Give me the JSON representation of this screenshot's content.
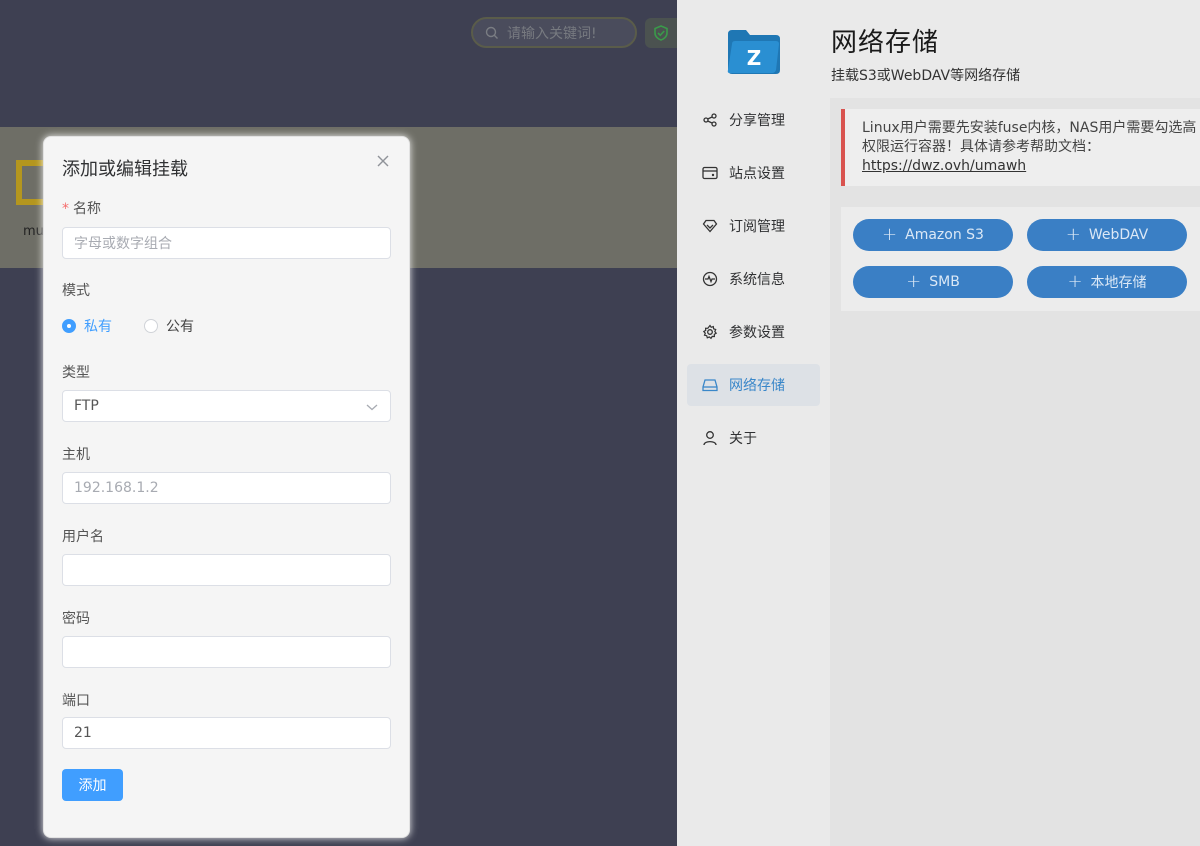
{
  "background": {
    "search_placeholder": "请输入关键词!",
    "fragment_text": "mu"
  },
  "sidebar": {
    "items": [
      {
        "label": "分享管理",
        "icon": "share-icon"
      },
      {
        "label": "站点设置",
        "icon": "site-icon"
      },
      {
        "label": "订阅管理",
        "icon": "subscription-icon"
      },
      {
        "label": "系统信息",
        "icon": "pulse-icon"
      },
      {
        "label": "参数设置",
        "icon": "gear-icon"
      },
      {
        "label": "网络存储",
        "icon": "drive-icon",
        "active": true
      },
      {
        "label": "关于",
        "icon": "user-icon"
      }
    ]
  },
  "page": {
    "title": "网络存储",
    "subtitle": "挂载S3或WebDAV等网络存储",
    "alert_text": "Linux用户需要先安装fuse内核，NAS用户需要勾选高权限运行容器！具体请参考帮助文档：",
    "alert_link": "https://dwz.ovh/umawh",
    "buttons": [
      {
        "label": "Amazon S3"
      },
      {
        "label": "WebDAV"
      },
      {
        "label": "SMB"
      },
      {
        "label": "本地存储"
      }
    ]
  },
  "modal": {
    "title": "添加或编辑挂载",
    "name_label": "名称",
    "name_placeholder": "字母或数字组合",
    "mode_label": "模式",
    "mode_options": [
      {
        "label": "私有",
        "selected": true
      },
      {
        "label": "公有",
        "selected": false
      }
    ],
    "type_label": "类型",
    "type_value": "FTP",
    "host_label": "主机",
    "host_placeholder": "192.168.1.2",
    "username_label": "用户名",
    "username_value": "",
    "password_label": "密码",
    "password_value": "",
    "port_label": "端口",
    "port_value": "21",
    "submit_label": "添加"
  },
  "colors": {
    "primary": "#409eff",
    "pill": "#3a7fc5",
    "alert_border": "#d9534f",
    "overlay": "#3e4052"
  }
}
